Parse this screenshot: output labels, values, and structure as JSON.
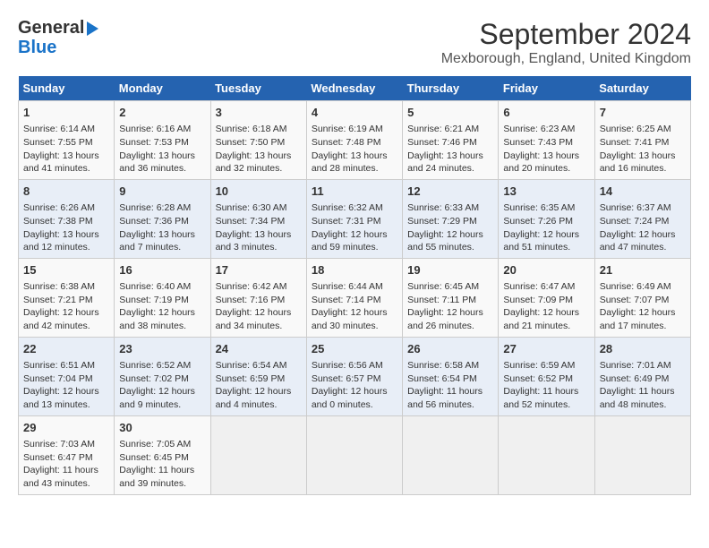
{
  "logo": {
    "line1": "General",
    "line2": "Blue",
    "arrow": true
  },
  "title": "September 2024",
  "subtitle": "Mexborough, England, United Kingdom",
  "weekdays": [
    "Sunday",
    "Monday",
    "Tuesday",
    "Wednesday",
    "Thursday",
    "Friday",
    "Saturday"
  ],
  "weeks": [
    [
      {
        "day": "1",
        "info": "Sunrise: 6:14 AM\nSunset: 7:55 PM\nDaylight: 13 hours\nand 41 minutes."
      },
      {
        "day": "2",
        "info": "Sunrise: 6:16 AM\nSunset: 7:53 PM\nDaylight: 13 hours\nand 36 minutes."
      },
      {
        "day": "3",
        "info": "Sunrise: 6:18 AM\nSunset: 7:50 PM\nDaylight: 13 hours\nand 32 minutes."
      },
      {
        "day": "4",
        "info": "Sunrise: 6:19 AM\nSunset: 7:48 PM\nDaylight: 13 hours\nand 28 minutes."
      },
      {
        "day": "5",
        "info": "Sunrise: 6:21 AM\nSunset: 7:46 PM\nDaylight: 13 hours\nand 24 minutes."
      },
      {
        "day": "6",
        "info": "Sunrise: 6:23 AM\nSunset: 7:43 PM\nDaylight: 13 hours\nand 20 minutes."
      },
      {
        "day": "7",
        "info": "Sunrise: 6:25 AM\nSunset: 7:41 PM\nDaylight: 13 hours\nand 16 minutes."
      }
    ],
    [
      {
        "day": "8",
        "info": "Sunrise: 6:26 AM\nSunset: 7:38 PM\nDaylight: 13 hours\nand 12 minutes."
      },
      {
        "day": "9",
        "info": "Sunrise: 6:28 AM\nSunset: 7:36 PM\nDaylight: 13 hours\nand 7 minutes."
      },
      {
        "day": "10",
        "info": "Sunrise: 6:30 AM\nSunset: 7:34 PM\nDaylight: 13 hours\nand 3 minutes."
      },
      {
        "day": "11",
        "info": "Sunrise: 6:32 AM\nSunset: 7:31 PM\nDaylight: 12 hours\nand 59 minutes."
      },
      {
        "day": "12",
        "info": "Sunrise: 6:33 AM\nSunset: 7:29 PM\nDaylight: 12 hours\nand 55 minutes."
      },
      {
        "day": "13",
        "info": "Sunrise: 6:35 AM\nSunset: 7:26 PM\nDaylight: 12 hours\nand 51 minutes."
      },
      {
        "day": "14",
        "info": "Sunrise: 6:37 AM\nSunset: 7:24 PM\nDaylight: 12 hours\nand 47 minutes."
      }
    ],
    [
      {
        "day": "15",
        "info": "Sunrise: 6:38 AM\nSunset: 7:21 PM\nDaylight: 12 hours\nand 42 minutes."
      },
      {
        "day": "16",
        "info": "Sunrise: 6:40 AM\nSunset: 7:19 PM\nDaylight: 12 hours\nand 38 minutes."
      },
      {
        "day": "17",
        "info": "Sunrise: 6:42 AM\nSunset: 7:16 PM\nDaylight: 12 hours\nand 34 minutes."
      },
      {
        "day": "18",
        "info": "Sunrise: 6:44 AM\nSunset: 7:14 PM\nDaylight: 12 hours\nand 30 minutes."
      },
      {
        "day": "19",
        "info": "Sunrise: 6:45 AM\nSunset: 7:11 PM\nDaylight: 12 hours\nand 26 minutes."
      },
      {
        "day": "20",
        "info": "Sunrise: 6:47 AM\nSunset: 7:09 PM\nDaylight: 12 hours\nand 21 minutes."
      },
      {
        "day": "21",
        "info": "Sunrise: 6:49 AM\nSunset: 7:07 PM\nDaylight: 12 hours\nand 17 minutes."
      }
    ],
    [
      {
        "day": "22",
        "info": "Sunrise: 6:51 AM\nSunset: 7:04 PM\nDaylight: 12 hours\nand 13 minutes."
      },
      {
        "day": "23",
        "info": "Sunrise: 6:52 AM\nSunset: 7:02 PM\nDaylight: 12 hours\nand 9 minutes."
      },
      {
        "day": "24",
        "info": "Sunrise: 6:54 AM\nSunset: 6:59 PM\nDaylight: 12 hours\nand 4 minutes."
      },
      {
        "day": "25",
        "info": "Sunrise: 6:56 AM\nSunset: 6:57 PM\nDaylight: 12 hours\nand 0 minutes."
      },
      {
        "day": "26",
        "info": "Sunrise: 6:58 AM\nSunset: 6:54 PM\nDaylight: 11 hours\nand 56 minutes."
      },
      {
        "day": "27",
        "info": "Sunrise: 6:59 AM\nSunset: 6:52 PM\nDaylight: 11 hours\nand 52 minutes."
      },
      {
        "day": "28",
        "info": "Sunrise: 7:01 AM\nSunset: 6:49 PM\nDaylight: 11 hours\nand 48 minutes."
      }
    ],
    [
      {
        "day": "29",
        "info": "Sunrise: 7:03 AM\nSunset: 6:47 PM\nDaylight: 11 hours\nand 43 minutes."
      },
      {
        "day": "30",
        "info": "Sunrise: 7:05 AM\nSunset: 6:45 PM\nDaylight: 11 hours\nand 39 minutes."
      },
      {
        "day": "",
        "info": ""
      },
      {
        "day": "",
        "info": ""
      },
      {
        "day": "",
        "info": ""
      },
      {
        "day": "",
        "info": ""
      },
      {
        "day": "",
        "info": ""
      }
    ]
  ]
}
